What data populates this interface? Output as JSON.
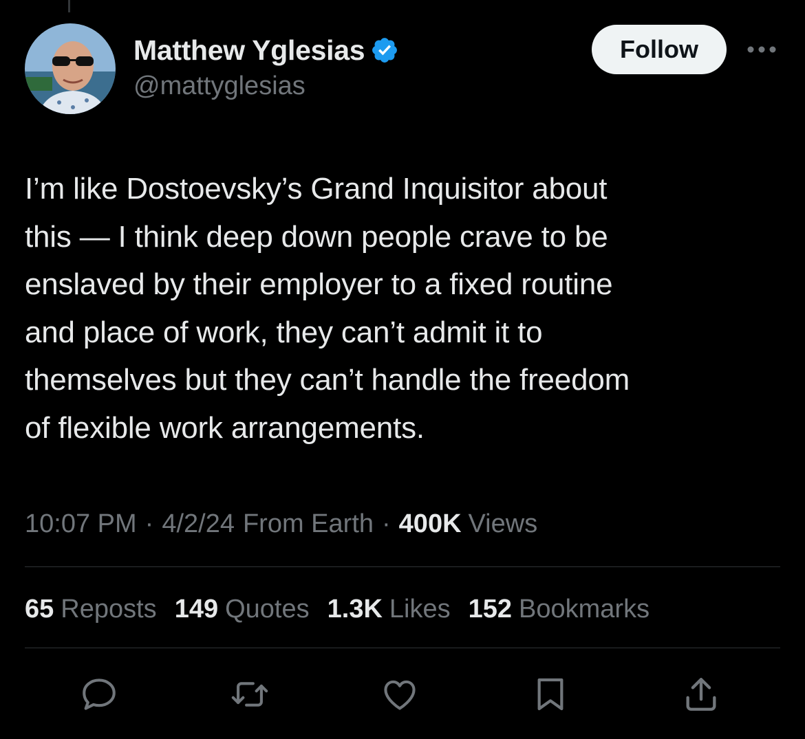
{
  "author": {
    "display_name": "Matthew Yglesias",
    "handle": "@mattyglesias",
    "verified_icon": "verified-badge-icon"
  },
  "follow_label": "Follow",
  "tweet": {
    "text": "I’m like Dostoevsky’s Grand Inquisitor about\nthis — I think deep down people crave to be\nenslaved by their employer to a fixed routine\nand place of work, they can’t admit it to\nthemselves but they can’t handle the freedom\nof flexible work arrangements."
  },
  "meta": {
    "time": "10:07 PM",
    "date": "4/2/24",
    "source": "From Earth",
    "separator": "·",
    "views_count": "400K",
    "views_label": "Views"
  },
  "stats": {
    "reposts_count": "65",
    "reposts_label": "Reposts",
    "quotes_count": "149",
    "quotes_label": "Quotes",
    "likes_count": "1.3K",
    "likes_label": "Likes",
    "bookmarks_count": "152",
    "bookmarks_label": "Bookmarks"
  },
  "actions": [
    "reply-icon",
    "repost-icon",
    "like-icon",
    "bookmark-icon",
    "share-icon"
  ],
  "colors": {
    "background": "#000000",
    "primary_text": "#e7e9ea",
    "secondary_text": "#71767b",
    "divider": "#2f3336",
    "verified": "#1d9bf0",
    "follow_button_bg": "#eff3f4"
  }
}
